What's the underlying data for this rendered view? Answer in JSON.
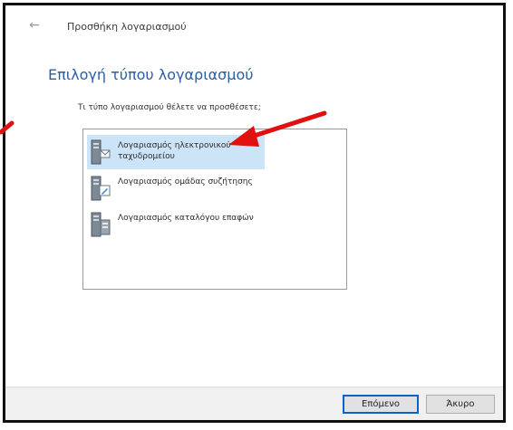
{
  "window": {
    "title": "Προσθήκη λογαριασμού",
    "back_icon": "back-arrow-icon"
  },
  "main": {
    "heading": "Επιλογή τύπου λογαριασμού",
    "prompt": "Τι τύπο λογαριασμού θέλετε να προσθέσετε;",
    "account_types": [
      {
        "label": "Λογαριασμός ηλεκτρονικού ταχυδρομείου",
        "icon": "email-account-icon",
        "selected": true
      },
      {
        "label": "Λογαριασμός ομάδας συζήτησης",
        "icon": "newsgroup-account-icon",
        "selected": false
      },
      {
        "label": "Λογαριασμός καταλόγου επαφών",
        "icon": "directory-account-icon",
        "selected": false
      }
    ]
  },
  "footer": {
    "next_label": "Επόμενο",
    "cancel_label": "Άκυρο"
  },
  "annotation": {
    "arrow_color": "#e01010"
  },
  "colors": {
    "heading": "#2a5fa8",
    "selection": "#cce4f7",
    "primary_border": "#0a64c8"
  }
}
